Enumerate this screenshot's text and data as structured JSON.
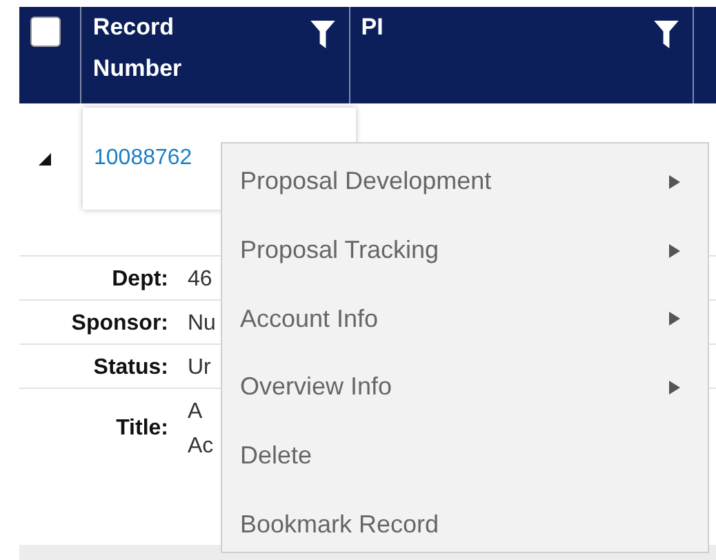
{
  "table": {
    "select_all": {
      "checked": false
    },
    "columns": [
      {
        "label": "Record Number",
        "filter": true
      },
      {
        "label": "PI",
        "filter": true
      }
    ],
    "rows": [
      {
        "expanded": true,
        "record_number": "10088762",
        "details": [
          {
            "label": "Dept:",
            "value": [
              "46"
            ]
          },
          {
            "label": "Sponsor:",
            "value": [
              "Nu"
            ]
          },
          {
            "label": "Status:",
            "value": [
              "Ur"
            ]
          },
          {
            "label": "Title:",
            "value": [
              "A",
              "Ac"
            ]
          }
        ]
      }
    ]
  },
  "context_menu": {
    "items": [
      {
        "label": "Proposal Development",
        "submenu": true
      },
      {
        "label": "Proposal Tracking",
        "submenu": true
      },
      {
        "label": "Account Info",
        "submenu": true
      },
      {
        "label": "Overview Info",
        "submenu": true
      },
      {
        "label": "Delete",
        "submenu": false
      },
      {
        "label": "Bookmark Record",
        "submenu": false
      }
    ]
  }
}
